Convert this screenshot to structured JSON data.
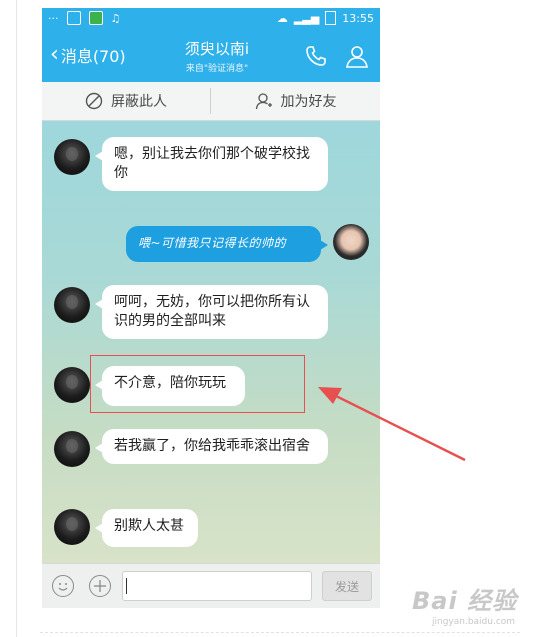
{
  "statusbar": {
    "dots": "···",
    "time": "13:55"
  },
  "header": {
    "back_label": "消息(70)",
    "title": "须臾以南i",
    "subtitle": "来自\"验证消息\""
  },
  "actions": {
    "block_label": "屏蔽此人",
    "add_friend_label": "加为好友"
  },
  "messages": [
    {
      "from": "other",
      "text": "嗯，别让我去你们那个破学校找你"
    },
    {
      "from": "self",
      "text": "喂~可惜我只记得长的帅的"
    },
    {
      "from": "other",
      "text": "呵呵，无妨，你可以把你所有认识的男的全部叫来"
    },
    {
      "from": "other",
      "text": "不介意，陪你玩玩"
    },
    {
      "from": "other",
      "text": "若我赢了，你给我乖乖滚出宿舍"
    },
    {
      "from": "other",
      "text": "别欺人太甚"
    }
  ],
  "input": {
    "value": "",
    "send_label": "发送"
  },
  "annotation": {
    "color": "#e85050"
  },
  "watermark": {
    "main": "Bai 经验",
    "sub": "jingyan.baidu.com"
  },
  "colors": {
    "header": "#2eb0ea",
    "self_bubble": "#1d9fe0",
    "accent_red": "#e85050"
  }
}
